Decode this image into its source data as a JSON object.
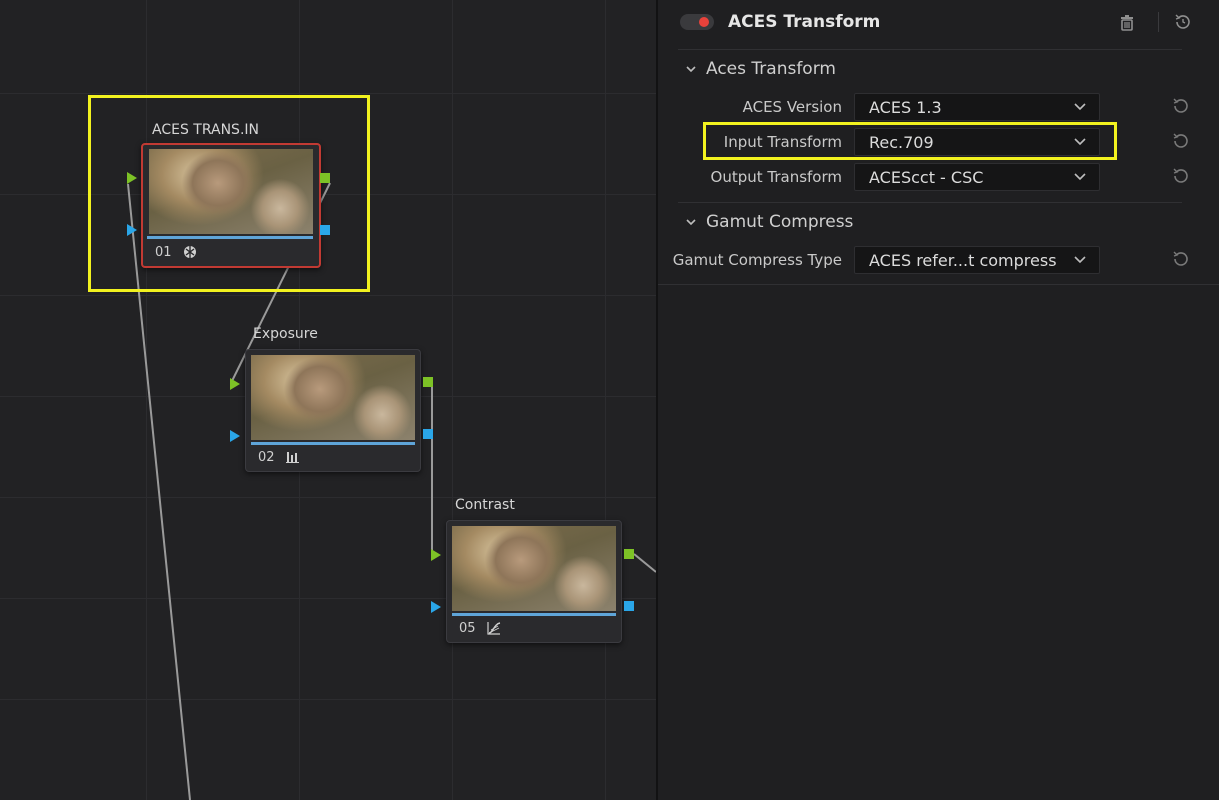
{
  "nodes": [
    {
      "label": "ACES TRANS.IN",
      "number": "01",
      "icon": "aces-globe-icon",
      "selected": true
    },
    {
      "label": "Exposure",
      "number": "02",
      "icon": "bars-icon",
      "selected": false
    },
    {
      "label": "Contrast",
      "number": "05",
      "icon": "curve-icon",
      "selected": false
    }
  ],
  "panel": {
    "title": "ACES Transform",
    "enabled": true,
    "sections": {
      "aces": {
        "title": "Aces Transform",
        "rows": [
          {
            "label": "ACES Version",
            "value": "ACES 1.3"
          },
          {
            "label": "Input Transform",
            "value": "Rec.709"
          },
          {
            "label": "Output Transform",
            "value": "ACEScct - CSC"
          }
        ]
      },
      "gamut": {
        "title": "Gamut Compress",
        "rows": [
          {
            "label": "Gamut Compress Type",
            "value": "ACES refer...t compress"
          }
        ]
      }
    }
  },
  "colors": {
    "highlight": "#f2f21f",
    "selected_border": "#c23a33",
    "port_green": "#7dc226",
    "port_blue": "#2aa6e8",
    "toggle_on": "#e8423b"
  }
}
